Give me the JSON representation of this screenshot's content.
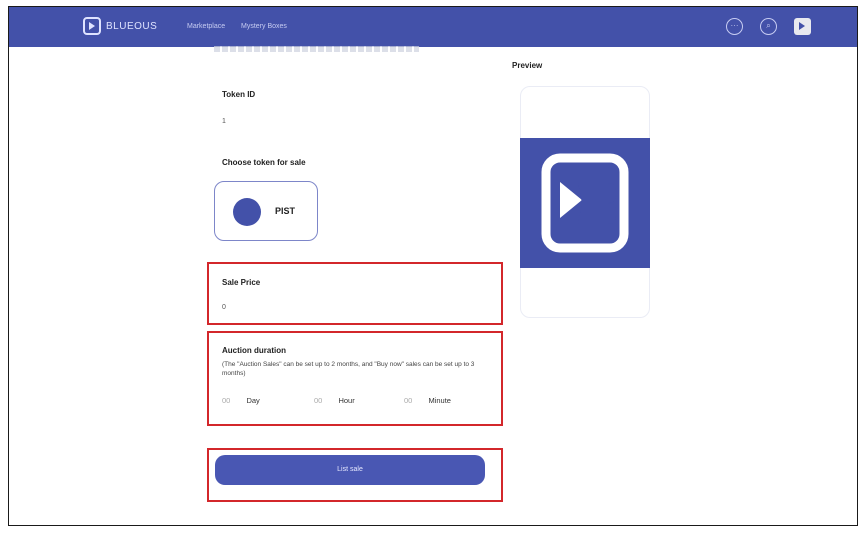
{
  "nav": {
    "logo_text": "BLUEOUS",
    "links": [
      "Marketplace",
      "Mystery Boxes"
    ],
    "more_icon": "ellipsis-icon",
    "search_icon": "search-icon",
    "wallet_icon": "wallet-logo-icon"
  },
  "form": {
    "token_id_label": "Token ID",
    "token_id_value": "1",
    "choose_token_label": "Choose token for sale",
    "token_option": "PIST",
    "sale_price_label": "Sale Price",
    "sale_price_value": "0",
    "auction_label": "Auction duration",
    "auction_note": "(The \"Auction Sales\" can be set up to 2 months, and \"Buy now\" sales can be set up to 3 months)",
    "duration": [
      {
        "value": "00",
        "unit": "Day"
      },
      {
        "value": "00",
        "unit": "Hour"
      },
      {
        "value": "00",
        "unit": "Minute"
      }
    ],
    "submit_label": "List sale"
  },
  "preview": {
    "label": "Preview"
  },
  "colors": {
    "brand": "#4351a9",
    "highlight": "#d3272b"
  }
}
